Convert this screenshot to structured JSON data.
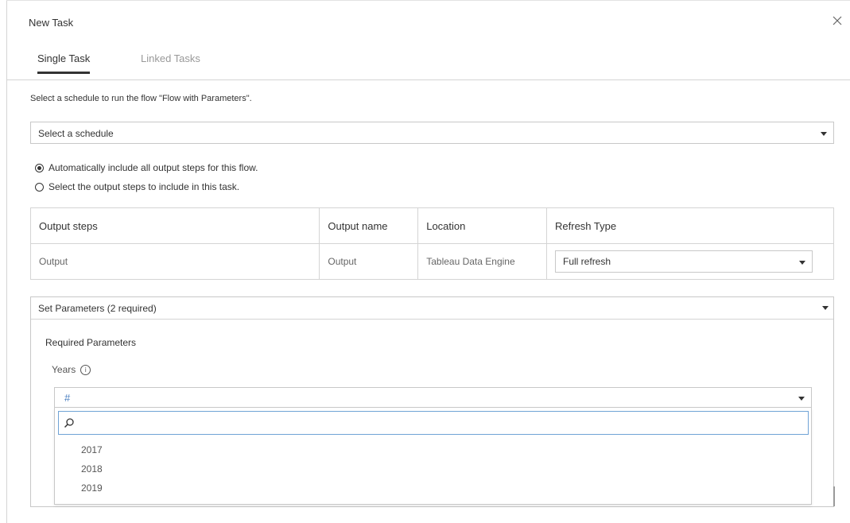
{
  "dialog": {
    "title": "New Task"
  },
  "tabs": [
    {
      "label": "Single Task",
      "active": true
    },
    {
      "label": "Linked Tasks",
      "active": false
    }
  ],
  "instruction": "Select a schedule to run the flow \"Flow with Parameters\".",
  "schedule": {
    "placeholder": "Select a schedule"
  },
  "output_options": [
    {
      "label": "Automatically include all output steps for this flow.",
      "selected": true
    },
    {
      "label": "Select the output steps to include in this task.",
      "selected": false
    }
  ],
  "output_table": {
    "headers": [
      "Output steps",
      "Output name",
      "Location",
      "Refresh Type"
    ],
    "rows": [
      {
        "step": "Output",
        "name": "Output",
        "location": "Tableau Data Engine",
        "refresh": "Full refresh"
      }
    ]
  },
  "parameters": {
    "header": "Set Parameters (2 required)",
    "section_title": "Required Parameters",
    "param_label": "Years",
    "param_type_symbol": "#",
    "options": [
      "2017",
      "2018",
      "2019"
    ]
  },
  "colors": {
    "accent": "#4a7fc0",
    "border": "#c8c8c8",
    "focus": "#6fa3d6"
  }
}
